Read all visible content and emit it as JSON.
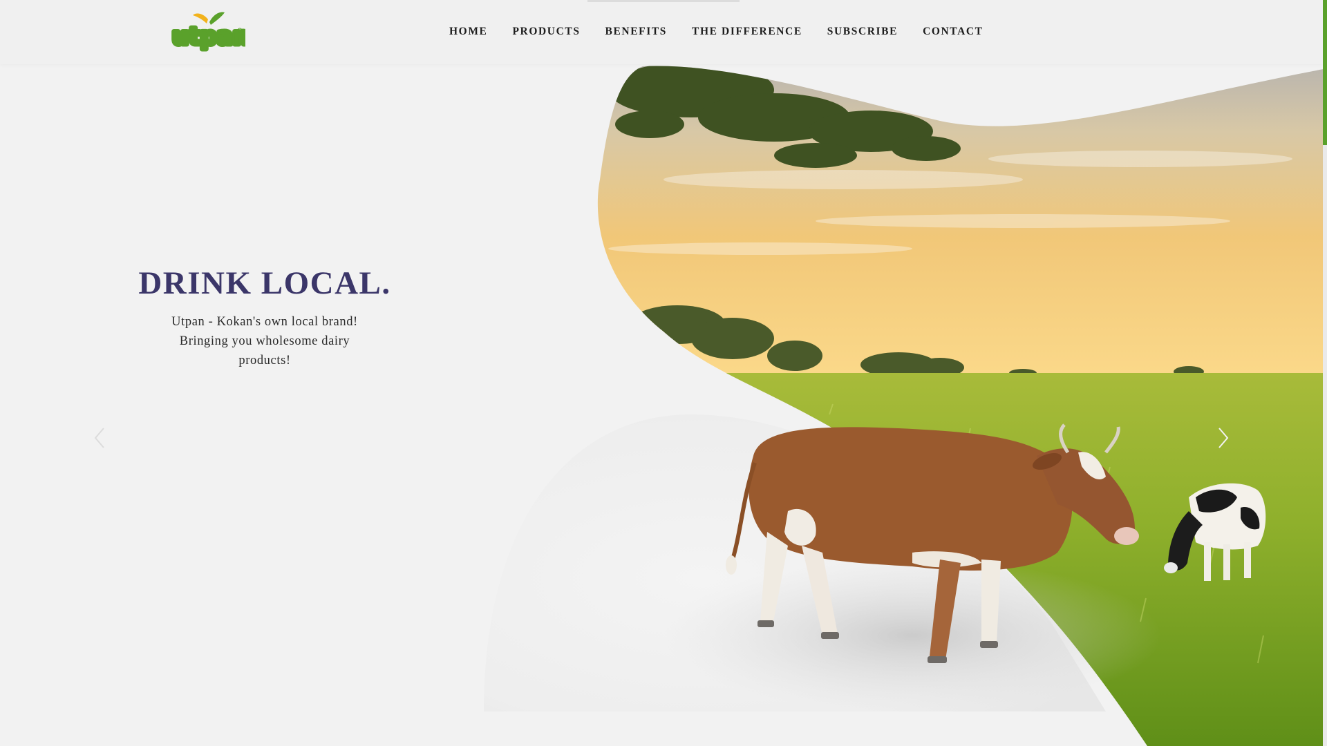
{
  "brand": {
    "logo_text": "utpan",
    "primary_color": "#5aa12b",
    "accent_color": "#f2b21b",
    "title_color": "#3b3669"
  },
  "nav": {
    "items": [
      {
        "label": "HOME"
      },
      {
        "label": "PRODUCTS"
      },
      {
        "label": "BENEFITS"
      },
      {
        "label": "THE DIFFERENCE"
      },
      {
        "label": "SUBSCRIBE"
      },
      {
        "label": "CONTACT"
      }
    ]
  },
  "hero": {
    "title": "DRINK LOCAL.",
    "subtitle": "Utpan - Kokan's own local brand! Bringing you wholesome dairy products!"
  },
  "slider": {
    "prev_icon": "chevron-left-icon",
    "next_icon": "chevron-right-icon"
  }
}
